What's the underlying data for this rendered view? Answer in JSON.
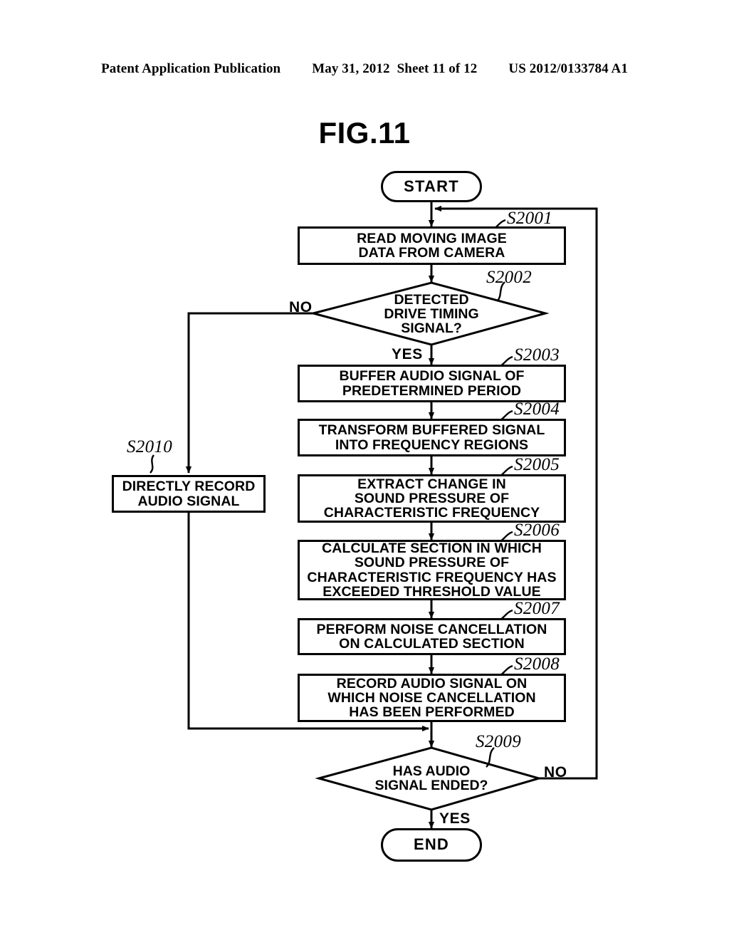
{
  "header": {
    "publication": "Patent Application Publication",
    "date": "May 31, 2012",
    "sheet": "Sheet 11 of 12",
    "patent_number": "US 2012/0133784 A1"
  },
  "figure": {
    "title": "FIG.11"
  },
  "flowchart": {
    "start_label": "START",
    "end_label": "END",
    "nodes": [
      {
        "id": "S2001",
        "type": "process",
        "ref": "S2001",
        "lines": [
          "READ MOVING IMAGE",
          "DATA FROM CAMERA"
        ]
      },
      {
        "id": "S2002",
        "type": "decision",
        "ref": "S2002",
        "lines": [
          "DETECTED",
          "DRIVE TIMING",
          "SIGNAL?"
        ],
        "yes_label": "YES",
        "no_label": "NO"
      },
      {
        "id": "S2003",
        "type": "process",
        "ref": "S2003",
        "lines": [
          "BUFFER AUDIO SIGNAL OF",
          "PREDETERMINED PERIOD"
        ]
      },
      {
        "id": "S2004",
        "type": "process",
        "ref": "S2004",
        "lines": [
          "TRANSFORM BUFFERED SIGNAL",
          "INTO FREQUENCY REGIONS"
        ]
      },
      {
        "id": "S2005",
        "type": "process",
        "ref": "S2005",
        "lines": [
          "EXTRACT CHANGE IN",
          "SOUND PRESSURE OF",
          "CHARACTERISTIC FREQUENCY"
        ]
      },
      {
        "id": "S2006",
        "type": "process",
        "ref": "S2006",
        "lines": [
          "CALCULATE SECTION IN WHICH",
          "SOUND PRESSURE OF",
          "CHARACTERISTIC FREQUENCY HAS",
          "EXCEEDED THRESHOLD VALUE"
        ]
      },
      {
        "id": "S2007",
        "type": "process",
        "ref": "S2007",
        "lines": [
          "PERFORM NOISE CANCELLATION",
          "ON CALCULATED SECTION"
        ]
      },
      {
        "id": "S2008",
        "type": "process",
        "ref": "S2008",
        "lines": [
          "RECORD AUDIO SIGNAL ON",
          "WHICH NOISE CANCELLATION",
          "HAS BEEN PERFORMED"
        ]
      },
      {
        "id": "S2009",
        "type": "decision",
        "ref": "S2009",
        "lines": [
          "HAS AUDIO",
          "SIGNAL ENDED?"
        ],
        "yes_label": "YES",
        "no_label": "NO"
      },
      {
        "id": "S2010",
        "type": "process",
        "ref": "S2010",
        "lines": [
          "DIRECTLY RECORD",
          "AUDIO SIGNAL"
        ]
      }
    ],
    "refs": {
      "s2001": "S2001",
      "s2002": "S2002",
      "s2003": "S2003",
      "s2004": "S2004",
      "s2005": "S2005",
      "s2006": "S2006",
      "s2007": "S2007",
      "s2008": "S2008",
      "s2009": "S2009",
      "s2010": "S2010"
    },
    "branch_labels": {
      "s2002_no": "NO",
      "s2002_yes": "YES",
      "s2009_no": "NO",
      "s2009_yes": "YES"
    },
    "text": {
      "s2001_l1": "READ MOVING IMAGE",
      "s2001_l2": "DATA FROM CAMERA",
      "s2002_l1": "DETECTED",
      "s2002_l2": "DRIVE TIMING",
      "s2002_l3": "SIGNAL?",
      "s2003_l1": "BUFFER AUDIO SIGNAL OF",
      "s2003_l2": "PREDETERMINED PERIOD",
      "s2004_l1": "TRANSFORM BUFFERED SIGNAL",
      "s2004_l2": "INTO FREQUENCY REGIONS",
      "s2005_l1": "EXTRACT CHANGE IN",
      "s2005_l2": "SOUND PRESSURE OF",
      "s2005_l3": "CHARACTERISTIC FREQUENCY",
      "s2006_l1": "CALCULATE SECTION IN WHICH",
      "s2006_l2": "SOUND PRESSURE OF",
      "s2006_l3": "CHARACTERISTIC FREQUENCY HAS",
      "s2006_l4": "EXCEEDED THRESHOLD VALUE",
      "s2007_l1": "PERFORM NOISE CANCELLATION",
      "s2007_l2": "ON CALCULATED SECTION",
      "s2008_l1": "RECORD AUDIO SIGNAL ON",
      "s2008_l2": "WHICH NOISE CANCELLATION",
      "s2008_l3": "HAS BEEN PERFORMED",
      "s2009_l1": "HAS AUDIO",
      "s2009_l2": "SIGNAL ENDED?",
      "s2010_l1": "DIRECTLY RECORD",
      "s2010_l2": "AUDIO SIGNAL"
    }
  },
  "colors": {
    "ink": "#000000",
    "paper": "#ffffff"
  }
}
